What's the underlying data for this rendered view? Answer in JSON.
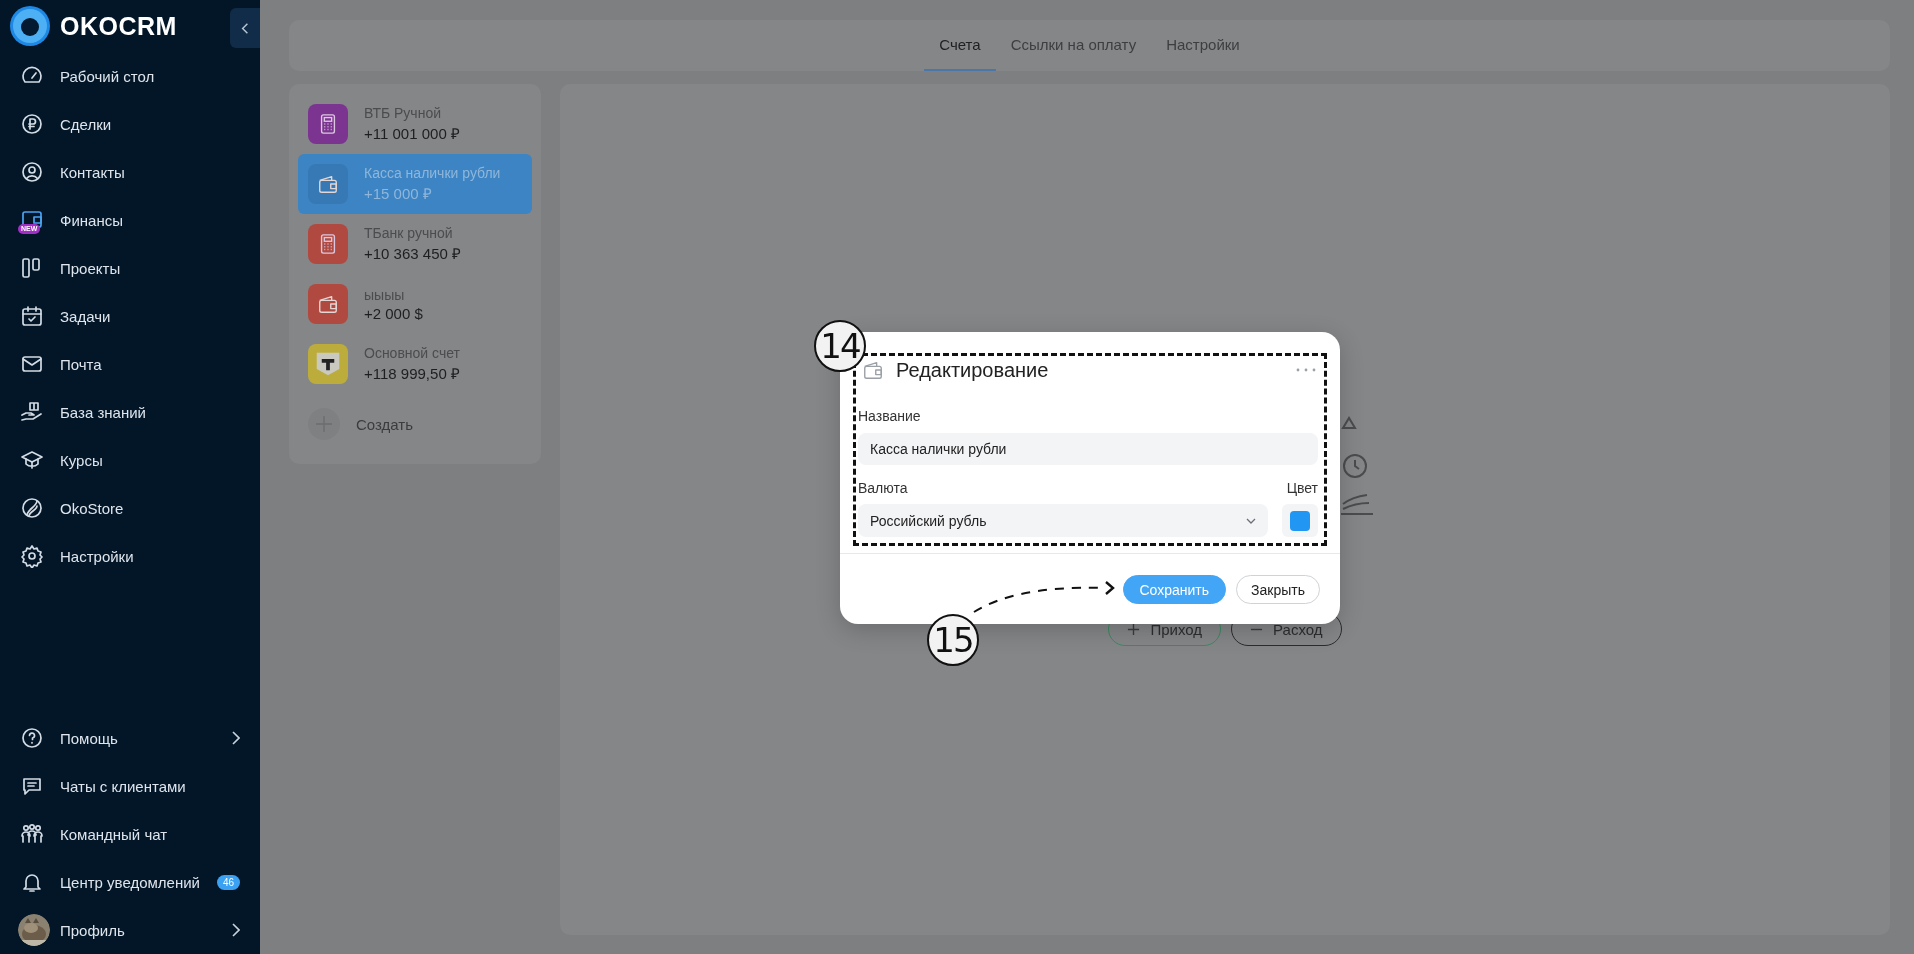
{
  "sidebar": {
    "logo": "OKOCRM",
    "items": [
      {
        "label": "Рабочий стол"
      },
      {
        "label": "Сделки"
      },
      {
        "label": "Контакты"
      },
      {
        "label": "Финансы",
        "badge": "NEW"
      },
      {
        "label": "Проекты"
      },
      {
        "label": "Задачи"
      },
      {
        "label": "Почта"
      },
      {
        "label": "База знаний"
      },
      {
        "label": "Курсы"
      },
      {
        "label": "OkoStore"
      },
      {
        "label": "Настройки"
      }
    ],
    "bottom_items": [
      {
        "label": "Помощь",
        "chevron": true
      },
      {
        "label": "Чаты с клиентами",
        "chevron": false
      },
      {
        "label": "Командный чат",
        "chevron": false
      },
      {
        "label": "Центр уведомлений",
        "chevron": false,
        "count": "46"
      },
      {
        "label": "Профиль",
        "chevron": true
      }
    ]
  },
  "tabs": [
    {
      "label": "Счета",
      "selected": true
    },
    {
      "label": "Ссылки на оплату",
      "selected": false
    },
    {
      "label": "Настройки",
      "selected": false
    }
  ],
  "accounts": [
    {
      "name": "ВТБ Ручной",
      "amount": "+11 001 000 ₽",
      "kind": "calculator",
      "color": "#7b3590",
      "selected": false
    },
    {
      "name": "Касса налички рубли",
      "amount": "+15 000 ₽",
      "kind": "wallet",
      "color": "#3779b4",
      "selected": true
    },
    {
      "name": "ТБанк ручной",
      "amount": "+10 363 450 ₽",
      "kind": "calculator",
      "color": "#b04a40",
      "selected": false
    },
    {
      "name": "ыыыы",
      "amount": "+2 000 $",
      "kind": "wallet",
      "color": "#b04a40",
      "selected": false
    },
    {
      "name": "Основной счет",
      "amount": "+118 999,50 ₽",
      "kind": "tbank",
      "color": "#bcac3c",
      "selected": false
    }
  ],
  "create_label": "Создать",
  "empty_state": {
    "buttons": [
      {
        "label": "Приход",
        "kind": "income"
      },
      {
        "label": "Расход",
        "kind": "expense"
      }
    ]
  },
  "modal": {
    "title": "Редактирование",
    "name_label": "Название",
    "name_value": "Касса налички рубли",
    "currency_label": "Валюта",
    "currency_value": "Российский рубль",
    "color_label": "Цвет",
    "color": "#2196f3",
    "buttons": [
      {
        "label": "Сохранить",
        "kind": "primary"
      },
      {
        "label": "Закрыть",
        "kind": "secondary"
      }
    ]
  },
  "annotations": [
    {
      "label": "14"
    },
    {
      "label": "15"
    }
  ]
}
